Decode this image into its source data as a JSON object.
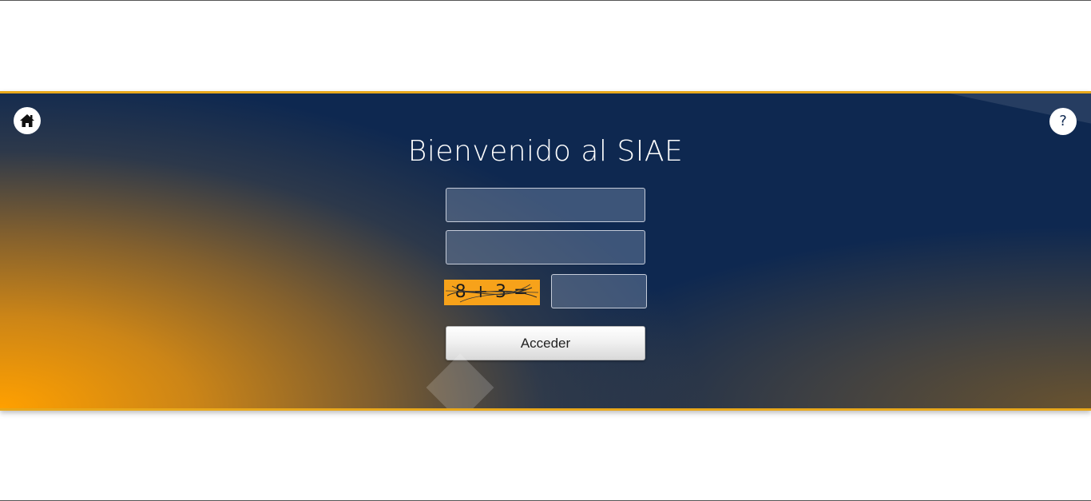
{
  "header": {
    "home_icon": "home-icon",
    "help_label": "?"
  },
  "login": {
    "title": "Bienvenido al SIAE",
    "username": {
      "value": "",
      "placeholder": ""
    },
    "password": {
      "value": "",
      "placeholder": ""
    },
    "captcha": {
      "challenge_text": "8 + 3 =",
      "answer_value": "",
      "background_color": "#f7a21a"
    },
    "submit_label": "Acceder"
  },
  "colors": {
    "navy": "#0e2850",
    "orange": "#ffa000",
    "border_gold": "#e8a81c"
  }
}
